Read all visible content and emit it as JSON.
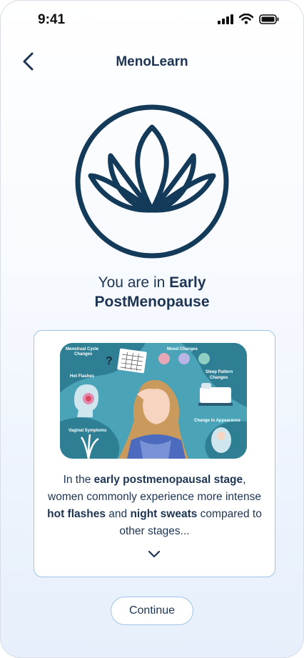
{
  "status_bar": {
    "time": "9:41"
  },
  "header": {
    "title": "MenoLearn"
  },
  "result": {
    "prefix": "You are in ",
    "stage_part1": "Early",
    "stage_part2": "PostMenopause"
  },
  "card": {
    "illustration_labels": {
      "menstrual": "Menstrual Cycle",
      "menstrual2": "Changes",
      "mood": "Mood Changes",
      "hot": "Hot Flashes",
      "sleep": "Sleep Pattern",
      "sleep2": "Changes",
      "vaginal": "Vaginal Symptoms",
      "appearance": "Change in Appearance"
    },
    "text": {
      "t1": "In the ",
      "b1": "early postmenopausal stage",
      "t2": ", women commonly experience more intense ",
      "b2": "hot flashes",
      "t3": " and ",
      "b3": "night sweats",
      "t4": " compared to other stages..."
    }
  },
  "actions": {
    "continue_label": "Continue"
  },
  "icons": {
    "back": "chevron-left-icon",
    "logo": "lotus-icon",
    "expand": "chevron-down-icon",
    "signal": "signal-icon",
    "wifi": "wifi-icon",
    "battery": "battery-icon"
  },
  "colors": {
    "primary": "#1d3452",
    "logo": "#143a5a",
    "border": "#9ec4ea",
    "illustration_bg": "#4aa3b6"
  }
}
